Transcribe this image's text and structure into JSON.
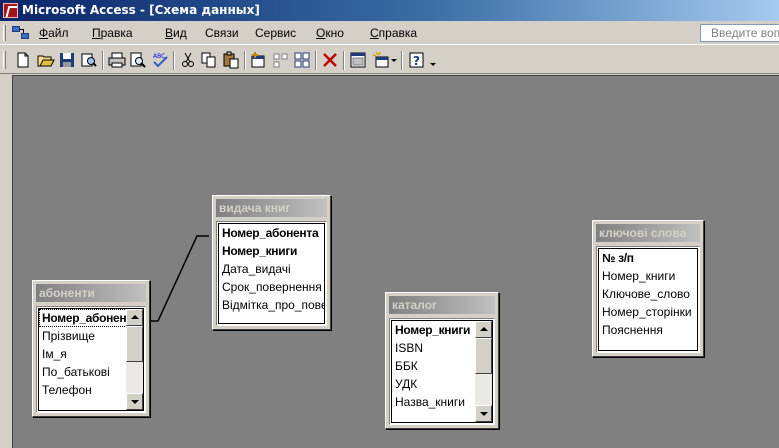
{
  "window": {
    "title": "Microsoft Access - [Схема данных]"
  },
  "menu": {
    "items": [
      {
        "label": "Файл",
        "accel": "Ф",
        "rest": "айл"
      },
      {
        "label": "Правка",
        "accel": "П",
        "rest": "равка"
      },
      {
        "label": "Вид",
        "accel": "В",
        "rest": "ид"
      },
      {
        "label": "Связи",
        "accel": "",
        "rest": "Связи"
      },
      {
        "label": "Сервис",
        "accel": "",
        "rest": "Сервис"
      },
      {
        "label": "Окно",
        "accel": "О",
        "rest": "кно"
      },
      {
        "label": "Справка",
        "accel": "С",
        "rest": "правка"
      }
    ],
    "help_placeholder": "Введите вопрос"
  },
  "toolbar": {
    "icons": [
      "new-icon",
      "open-icon",
      "save-icon",
      "file-search-icon",
      "print-icon",
      "print-preview-icon",
      "spelling-icon",
      "cut-icon",
      "copy-icon",
      "paste-icon",
      "show-table-icon",
      "show-direct-icon",
      "show-all-relationships-icon",
      "delete-icon",
      "database-window-icon",
      "new-object-icon",
      "dropdown-arrow-icon",
      "help-icon",
      "toolbar-options-icon"
    ]
  },
  "tables": {
    "abonenty": {
      "title": "абоненти",
      "fields": [
        {
          "name": "Номер_абонента",
          "key": true
        },
        {
          "name": "Прізвище",
          "key": false
        },
        {
          "name": "Ім_я",
          "key": false
        },
        {
          "name": "По_батькові",
          "key": false
        },
        {
          "name": "Телефон",
          "key": false
        }
      ]
    },
    "vydacha": {
      "title": "видача книг",
      "fields": [
        {
          "name": "Номер_абонента",
          "key": true
        },
        {
          "name": "Номер_книги",
          "key": true
        },
        {
          "name": "Дата_видачі",
          "key": false
        },
        {
          "name": "Срок_повернення",
          "key": false
        },
        {
          "name": "Відмітка_про_повернення",
          "key": false
        }
      ]
    },
    "katalog": {
      "title": "каталог",
      "fields": [
        {
          "name": "Номер_книги",
          "key": true
        },
        {
          "name": "ISBN",
          "key": false
        },
        {
          "name": "ББК",
          "key": false
        },
        {
          "name": "УДК",
          "key": false
        },
        {
          "name": "Назва_книги",
          "key": false
        }
      ]
    },
    "kliuchovi": {
      "title": "ключові слова",
      "fields": [
        {
          "name": "№ з/п",
          "key": true
        },
        {
          "name": "Номер_книги",
          "key": false
        },
        {
          "name": "Ключове_слово",
          "key": false
        },
        {
          "name": "Номер_сторінки",
          "key": false
        },
        {
          "name": "Пояснення",
          "key": false
        }
      ]
    }
  },
  "colors": {
    "title_gradient_start": "#0a246a",
    "title_gradient_end": "#a6caf0",
    "workspace": "#808080",
    "chrome": "#d4d0c8"
  }
}
